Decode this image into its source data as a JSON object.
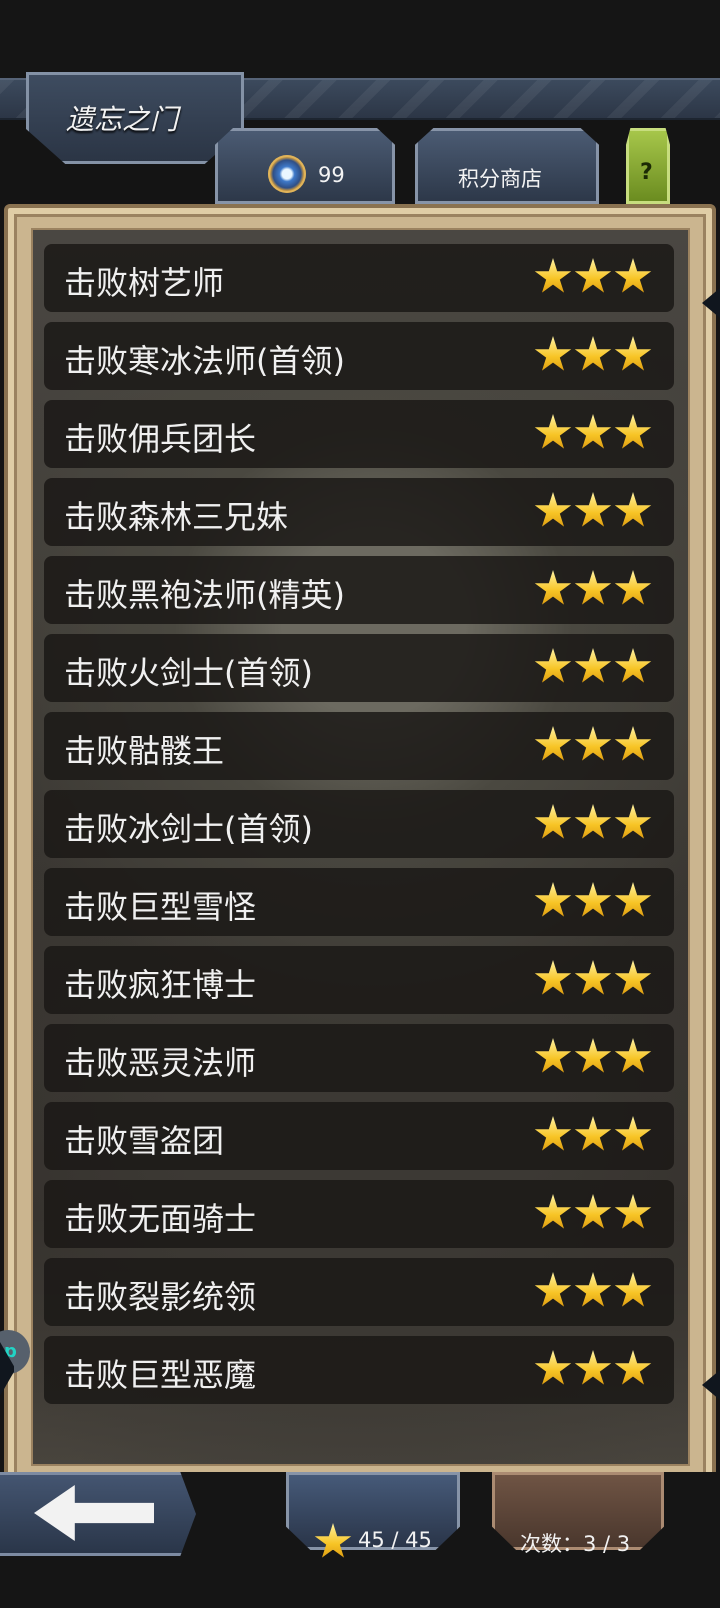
{
  "header": {
    "title": "遗忘之门"
  },
  "tabs": {
    "points_value": "99",
    "shop_label": "积分商店",
    "help_label": "?"
  },
  "missions": [
    {
      "name": "击败树艺师",
      "stars": 3
    },
    {
      "name": "击败寒冰法师(首领)",
      "stars": 3
    },
    {
      "name": "击败佣兵团长",
      "stars": 3
    },
    {
      "name": "击败森林三兄妹",
      "stars": 3
    },
    {
      "name": "击败黑袍法师(精英)",
      "stars": 3
    },
    {
      "name": "击败火剑士(首领)",
      "stars": 3
    },
    {
      "name": "击败骷髅王",
      "stars": 3
    },
    {
      "name": "击败冰剑士(首领)",
      "stars": 3
    },
    {
      "name": "击败巨型雪怪",
      "stars": 3
    },
    {
      "name": "击败疯狂博士",
      "stars": 3
    },
    {
      "name": "击败恶灵法师",
      "stars": 3
    },
    {
      "name": "击败雪盗团",
      "stars": 3
    },
    {
      "name": "击败无面骑士",
      "stars": 3
    },
    {
      "name": "击败裂影统领",
      "stars": 3
    },
    {
      "name": "击败巨型恶魔",
      "stars": 3
    }
  ],
  "footer": {
    "stars_text": "45 / 45",
    "attempts_text": "次数：3 / 3"
  },
  "side": {
    "bubble_text": "p"
  },
  "icons": {
    "points": "medal-icon",
    "star": "star-icon",
    "back": "back-arrow-icon"
  },
  "colors": {
    "header_navy": "#2c3646",
    "panel_parchment": "#cbb58f",
    "row_dark": "#1a1816",
    "star_gold": "#f7c425",
    "help_green": "#8fb437",
    "attempts_brown": "#5a4337"
  }
}
